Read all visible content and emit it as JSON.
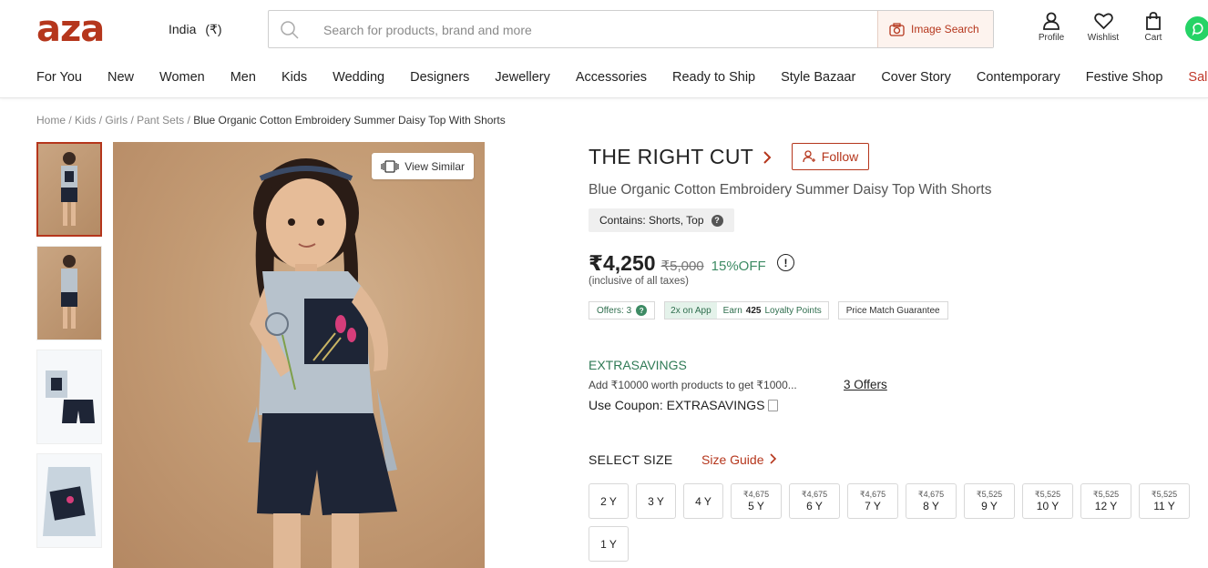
{
  "header": {
    "logo": "aza",
    "region": "India",
    "currency": "(₹)",
    "search_placeholder": "Search for products, brand and more",
    "image_search": "Image Search",
    "icons": [
      {
        "name": "Profile",
        "icon": "user-icon"
      },
      {
        "name": "Wishlist",
        "icon": "heart-icon"
      },
      {
        "name": "Cart",
        "icon": "bag-icon"
      }
    ]
  },
  "nav": [
    "For You",
    "New",
    "Women",
    "Men",
    "Kids",
    "Wedding",
    "Designers",
    "Jewellery",
    "Accessories",
    "Ready to Ship",
    "Style Bazaar",
    "Cover Story",
    "Contemporary",
    "Festive Shop",
    "Sale"
  ],
  "breadcrumb": {
    "items": [
      "Home",
      "Kids",
      "Girls",
      "Pant Sets"
    ],
    "separator": "/",
    "current": "Blue Organic Cotton Embroidery Summer Daisy Top With Shorts"
  },
  "gallery": {
    "view_similar": "View Similar"
  },
  "product": {
    "brand": "THE RIGHT CUT",
    "follow": "Follow",
    "name": "Blue Organic Cotton Embroidery Summer Daisy Top With Shorts",
    "contains": "Contains: Shorts, Top",
    "price": "₹4,250",
    "mrp": "₹5,000",
    "discount": "15%OFF",
    "tax_note": "(inclusive of all taxes)",
    "chips": {
      "offers": "Offers: 3",
      "app": "2x on App",
      "earn": "Earn",
      "points": "425",
      "points_label": "Loyalty Points",
      "price_match": "Price Match Guarantee"
    },
    "extra": {
      "title": "EXTRASAVINGS",
      "desc": "Add ₹10000 worth products to get ₹1000...",
      "offers_link": "3 Offers",
      "coupon": "Use Coupon: EXTRASAVINGS"
    },
    "size": {
      "label": "SELECT SIZE",
      "guide": "Size Guide",
      "options": [
        {
          "price": "",
          "label": "2 Y"
        },
        {
          "price": "",
          "label": "3 Y"
        },
        {
          "price": "",
          "label": "4 Y"
        },
        {
          "price": "₹4,675",
          "label": "5 Y"
        },
        {
          "price": "₹4,675",
          "label": "6 Y"
        },
        {
          "price": "₹4,675",
          "label": "7 Y"
        },
        {
          "price": "₹4,675",
          "label": "8 Y"
        },
        {
          "price": "₹5,525",
          "label": "9 Y"
        },
        {
          "price": "₹5,525",
          "label": "10 Y"
        },
        {
          "price": "₹5,525",
          "label": "12 Y"
        },
        {
          "price": "₹5,525",
          "label": "11 Y"
        },
        {
          "price": "",
          "label": "1 Y"
        }
      ]
    }
  },
  "colors": {
    "brand": "#b5361c",
    "accent_green": "#3d8b64"
  }
}
